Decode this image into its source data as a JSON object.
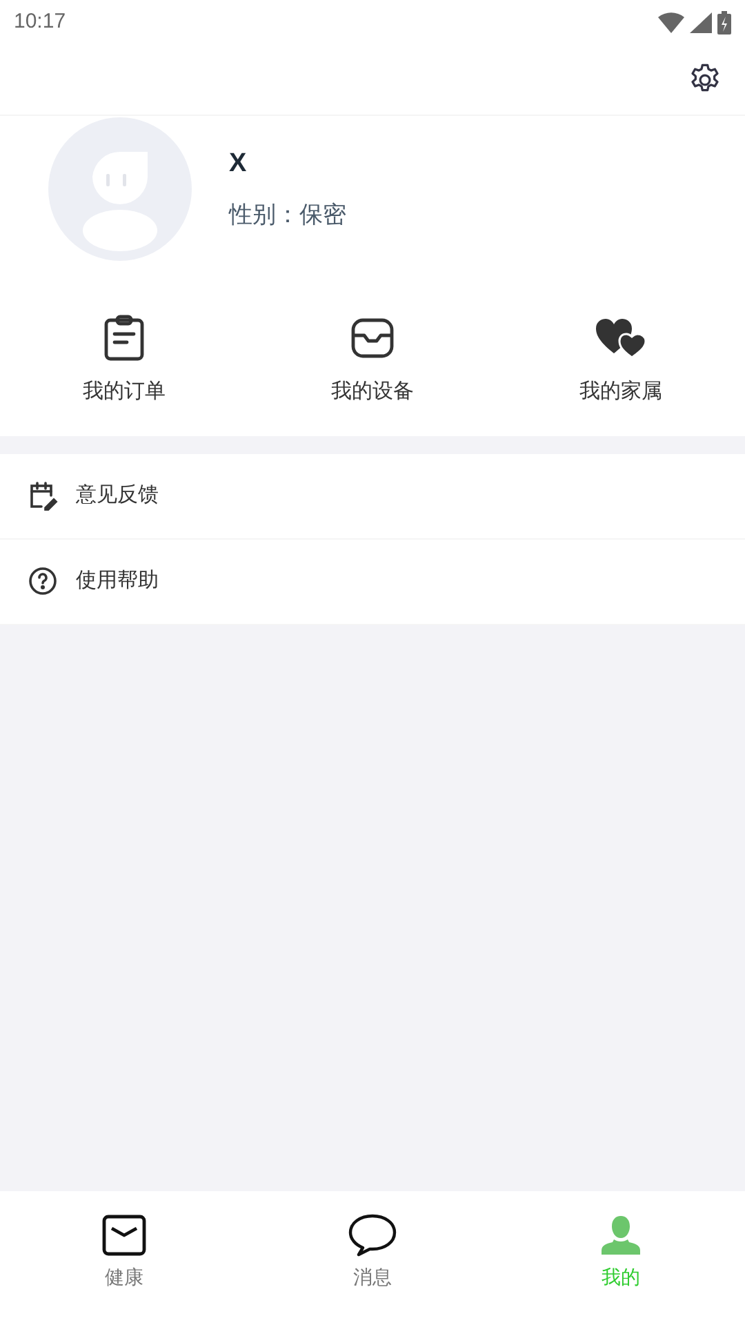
{
  "status_bar": {
    "time": "10:17"
  },
  "profile": {
    "name": "X",
    "gender": "性别：保密"
  },
  "shortcuts": [
    {
      "kind": "clipboard",
      "label": "我的订单"
    },
    {
      "kind": "tray",
      "label": "我的设备"
    },
    {
      "kind": "hearts",
      "label": "我的家属"
    }
  ],
  "menu": [
    {
      "kind": "feedback",
      "label": "意见反馈"
    },
    {
      "kind": "help",
      "label": "使用帮助"
    }
  ],
  "tabs": [
    {
      "kind": "mail",
      "label": "健康",
      "selected": false
    },
    {
      "kind": "chat",
      "label": "消息",
      "selected": false
    },
    {
      "kind": "person",
      "label": "我的",
      "selected": true
    }
  ]
}
